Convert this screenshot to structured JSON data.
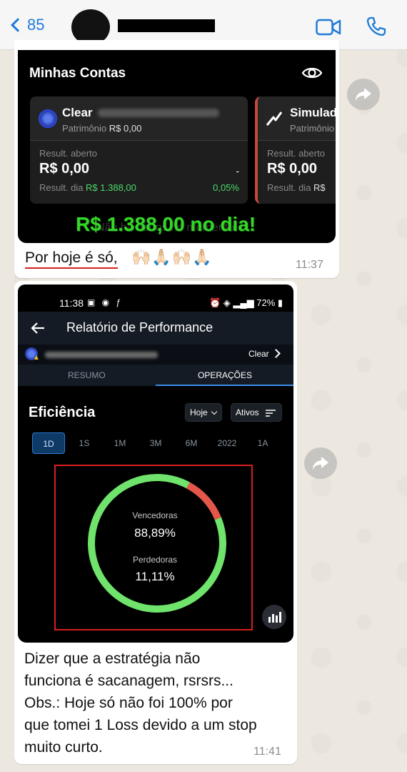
{
  "header": {
    "back_count": "85"
  },
  "message1": {
    "screenshot": {
      "section_title": "Minhas Contas",
      "accounts": [
        {
          "name": "Clear",
          "patrimonio_label": "Patrimônio",
          "patrimonio_value": "R$ 0,00",
          "result_open_label": "Result. aberto",
          "result_open_value": "R$ 0,00",
          "result_open_extra": "-",
          "result_day_label": "Result. dia",
          "result_day_value": "R$ 1.388,00",
          "result_day_pct": "0,05%"
        },
        {
          "name": "Simulad",
          "patrimonio_label": "Patrimônio",
          "result_open_label": "Result. aberto",
          "result_open_value": "R$ 0,00",
          "result_day_label": "Result. dia",
          "result_day_value": "R$"
        }
      ],
      "faded_text": "Não há dados no momento.",
      "overlay_text": "R$ 1.388,00 no dia!"
    },
    "caption": "Por hoje é só,",
    "emojis": "🙌🏻🙏🏻🙌🏻🙏🏻",
    "time": "11:37"
  },
  "message2": {
    "screenshot": {
      "status_time": "11:38",
      "status_battery": "72%",
      "app_title": "Relatório de Performance",
      "account_short": "Clear",
      "tabs": [
        {
          "label": "RESUMO",
          "active": false
        },
        {
          "label": "OPERAÇÕES",
          "active": true
        }
      ],
      "section_title": "Eficiência",
      "filter_period": "Hoje",
      "filter_assets": "Ativos",
      "periods": [
        "1D",
        "1S",
        "1M",
        "3M",
        "6M",
        "2022",
        "1A"
      ],
      "active_period": "1D",
      "donut": {
        "winners_label": "Vencedoras",
        "winners_value": "88,89%",
        "losers_label": "Perdedoras",
        "losers_value": "11,11%",
        "winners_fraction": 0.8889,
        "losers_fraction": 0.1111,
        "winners_color": "#6fe36b",
        "losers_color": "#e5564a"
      }
    },
    "caption_lines": [
      "Dizer que a estratégia não",
      "funciona é sacanagem, rsrsrs...",
      "Obs.: Hoje só não foi 100% por",
      "que tomei 1 Loss devido a um stop",
      "muito curto."
    ],
    "time": "11:41"
  },
  "colors": {
    "whatsapp_blue": "#1f7bd8",
    "highlight_red": "#d91e1e",
    "profit_green": "#4cd96a"
  }
}
